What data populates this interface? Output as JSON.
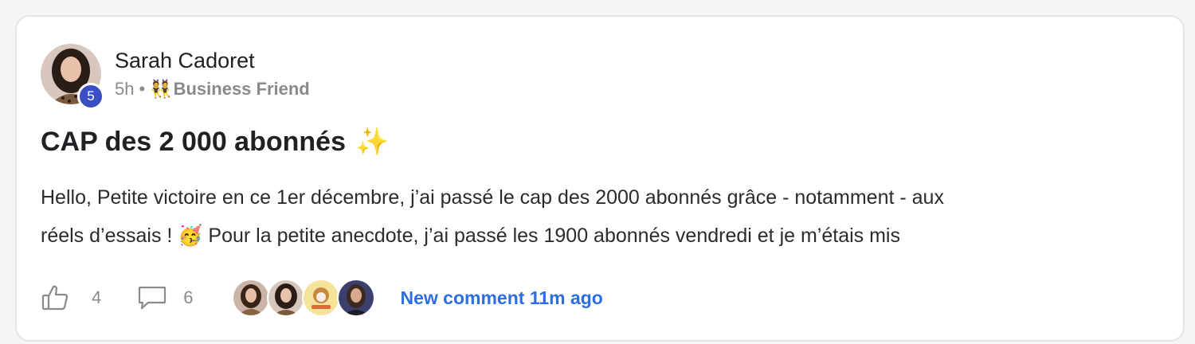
{
  "post": {
    "author": "Sarah Cadoret",
    "level": "5",
    "time": "5h",
    "separator": "•",
    "group_emoji": "👯",
    "group": "Business Friend",
    "title": "CAP des 2 000 abonnés",
    "title_emoji": "✨",
    "body_line1": "Hello, Petite victoire en ce 1er décembre, j’ai passé le cap des 2000 abonnés grâce - notamment - aux",
    "body_line2_a": "réels d’essais !",
    "body_emoji": "🥳",
    "body_line2_b": "Pour la petite anecdote, j’ai passé les 1900 abonnés vendredi et je m’étais mis"
  },
  "footer": {
    "likes": "4",
    "comments": "6",
    "commenters": [
      "commenter-1",
      "commenter-2",
      "commenter-3",
      "commenter-4"
    ],
    "new_comment": "New comment 11m ago"
  },
  "colors": {
    "badge": "#3b4fc4",
    "link": "#2b6fe0",
    "muted": "#8a8a8a"
  },
  "icons": {
    "like": "thumbs-up-icon",
    "comment": "comment-bubble-icon"
  }
}
